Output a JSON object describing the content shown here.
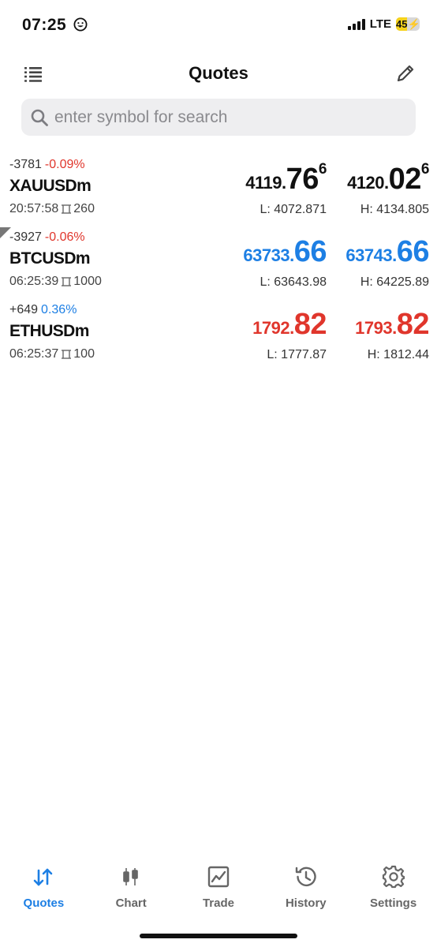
{
  "status": {
    "time": "07:25",
    "network": "LTE",
    "battery_level": "45"
  },
  "header": {
    "title": "Quotes"
  },
  "search": {
    "placeholder": "enter symbol for search"
  },
  "quotes": [
    {
      "change_points": "-3781",
      "change_pct": "-0.09%",
      "symbol": "XAUUSDm",
      "time": "20:57:58",
      "spread": "260",
      "bid": {
        "head": "4119.",
        "big": "76",
        "sup": "6"
      },
      "ask": {
        "head": "4120.",
        "big": "02",
        "sup": "6"
      },
      "low": "L: 4072.871",
      "high": "H: 4134.805"
    },
    {
      "change_points": "-3927",
      "change_pct": "-0.06%",
      "symbol": "BTCUSDm",
      "time": "06:25:39",
      "spread": "1000",
      "bid": {
        "head": "63733.",
        "big": "66",
        "sup": ""
      },
      "ask": {
        "head": "63743.",
        "big": "66",
        "sup": ""
      },
      "low": "L: 63643.98",
      "high": "H: 64225.89"
    },
    {
      "change_points": "+649",
      "change_pct": "0.36%",
      "symbol": "ETHUSDm",
      "time": "06:25:37",
      "spread": "100",
      "bid": {
        "head": "1792.",
        "big": "82",
        "sup": ""
      },
      "ask": {
        "head": "1793.",
        "big": "82",
        "sup": ""
      },
      "low": "L: 1777.87",
      "high": "H: 1812.44"
    }
  ],
  "tabs": [
    {
      "label": "Quotes",
      "icon": "quotes-arrows-icon"
    },
    {
      "label": "Chart",
      "icon": "candlestick-icon"
    },
    {
      "label": "Trade",
      "icon": "trade-chart-icon"
    },
    {
      "label": "History",
      "icon": "history-clock-icon"
    },
    {
      "label": "Settings",
      "icon": "gear-icon"
    }
  ],
  "colors": {
    "accent": "#1d7fe4",
    "down": "#e0362c",
    "up": "#1d7fe4",
    "search_bg": "#eeeef0"
  }
}
